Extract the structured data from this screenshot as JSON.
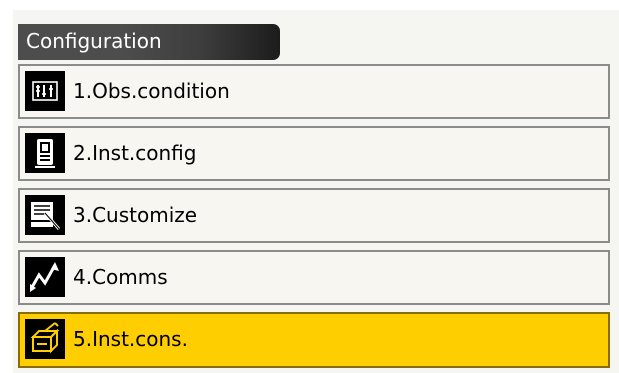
{
  "title": "Configuration",
  "menu": [
    {
      "label": "1.Obs.condition",
      "icon": "obs-condition-icon"
    },
    {
      "label": "2.Inst.config",
      "icon": "inst-config-icon"
    },
    {
      "label": "3.Customize",
      "icon": "customize-icon"
    },
    {
      "label": "4.Comms",
      "icon": "comms-icon"
    },
    {
      "label": "5.Inst.cons.",
      "icon": "inst-cons-icon",
      "selected": true
    }
  ],
  "colors": {
    "selected_background": "#ffce00",
    "title_bar": "#4d4d4d"
  }
}
